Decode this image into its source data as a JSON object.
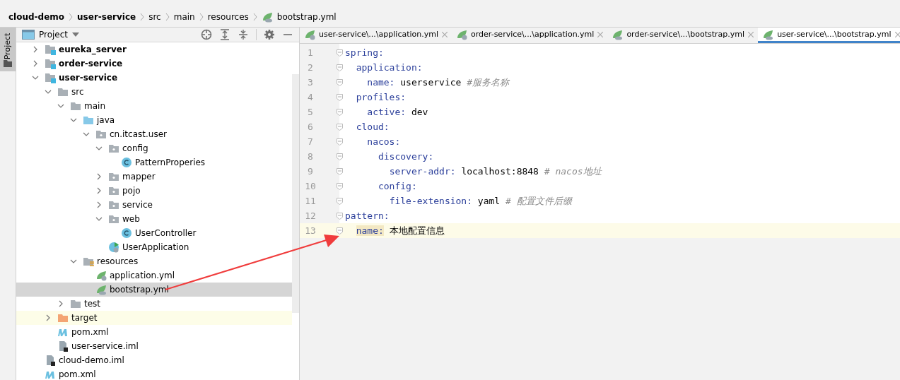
{
  "breadcrumb": [
    {
      "label": "cloud-demo",
      "kind": "module"
    },
    {
      "label": "user-service",
      "kind": "module"
    },
    {
      "label": "src",
      "kind": "folder"
    },
    {
      "label": "main",
      "kind": "folder"
    },
    {
      "label": "resources",
      "kind": "folder"
    },
    {
      "label": "bootstrap.yml",
      "kind": "bootstrap"
    }
  ],
  "side_tab": {
    "label": "Project",
    "selected": true
  },
  "project_panel": {
    "title": "Project",
    "tree": [
      {
        "label": "eureka_server",
        "kind": "module",
        "expanded": false,
        "selected": false
      },
      {
        "label": "order-service",
        "kind": "module",
        "expanded": false,
        "selected": false
      },
      {
        "label": "user-service",
        "kind": "module",
        "expanded": true,
        "selected": false,
        "children": [
          {
            "label": "src",
            "kind": "folder",
            "expanded": true,
            "selected": false,
            "children": [
              {
                "label": "main",
                "kind": "folder",
                "expanded": true,
                "selected": false,
                "children": [
                  {
                    "label": "java",
                    "kind": "source",
                    "expanded": true,
                    "selected": false,
                    "children": [
                      {
                        "label": "cn.itcast.user",
                        "kind": "package",
                        "expanded": true,
                        "selected": false,
                        "children": [
                          {
                            "label": "config",
                            "kind": "package",
                            "expanded": true,
                            "selected": false,
                            "children": [
                              {
                                "label": "PatternProperies",
                                "kind": "class",
                                "selected": false
                              }
                            ]
                          },
                          {
                            "label": "mapper",
                            "kind": "package",
                            "expanded": false,
                            "selected": false
                          },
                          {
                            "label": "pojo",
                            "kind": "package",
                            "expanded": false,
                            "selected": false
                          },
                          {
                            "label": "service",
                            "kind": "package",
                            "expanded": false,
                            "selected": false
                          },
                          {
                            "label": "web",
                            "kind": "package",
                            "expanded": true,
                            "selected": false,
                            "children": [
                              {
                                "label": "UserController",
                                "kind": "class",
                                "selected": false
                              }
                            ]
                          },
                          {
                            "label": "UserApplication",
                            "kind": "app",
                            "selected": false
                          }
                        ]
                      }
                    ]
                  },
                  {
                    "label": "resources",
                    "kind": "resources",
                    "expanded": true,
                    "selected": false,
                    "children": [
                      {
                        "label": "application.yml",
                        "kind": "application",
                        "selected": false
                      },
                      {
                        "label": "bootstrap.yml",
                        "kind": "bootstrap",
                        "selected": true
                      }
                    ]
                  }
                ]
              },
              {
                "label": "test",
                "kind": "folder",
                "expanded": false,
                "selected": false
              }
            ]
          },
          {
            "label": "target",
            "kind": "excluded",
            "expanded": false,
            "selected": false
          },
          {
            "label": "pom.xml",
            "kind": "maven",
            "selected": false
          },
          {
            "label": "user-service.iml",
            "kind": "iml",
            "selected": false
          }
        ]
      },
      {
        "label": "cloud-demo.iml",
        "kind": "iml",
        "selected": false
      },
      {
        "label": "pom.xml",
        "kind": "maven",
        "selected": false
      }
    ]
  },
  "tabs": [
    {
      "label": "user-service\\...\\application.yml",
      "kind": "application",
      "selected": false
    },
    {
      "label": "order-service\\...\\application.yml",
      "kind": "application",
      "selected": false
    },
    {
      "label": "order-service\\...\\bootstrap.yml",
      "kind": "bootstrap",
      "selected": false
    },
    {
      "label": "user-service\\...\\bootstrap.yml",
      "kind": "bootstrap",
      "selected": true
    }
  ],
  "code": [
    {
      "number": "1",
      "key": "spring:",
      "current": false
    },
    {
      "number": "2",
      "key": "  application:",
      "current": false
    },
    {
      "number": "3",
      "key": "    name:",
      "value": "userservice",
      "comment": "#服务名称",
      "current": false
    },
    {
      "number": "4",
      "key": "  profiles:",
      "current": false
    },
    {
      "number": "5",
      "key": "    active:",
      "value": "dev",
      "current": false
    },
    {
      "number": "6",
      "key": "  cloud:",
      "current": false
    },
    {
      "number": "7",
      "key": "    nacos:",
      "current": false
    },
    {
      "number": "8",
      "key": "      discovery:",
      "current": false
    },
    {
      "number": "9",
      "key": "        server-addr:",
      "value": "localhost:8848",
      "comment": "# nacos地址",
      "current": false
    },
    {
      "number": "10",
      "key": "      config:",
      "current": false
    },
    {
      "number": "11",
      "key": "        file-extension:",
      "value": "yaml",
      "comment": "# 配置文件后缀",
      "current": false
    },
    {
      "number": "12",
      "key": "pattern:",
      "current": false
    },
    {
      "number": "13",
      "key": "  name:",
      "value": "本地配置信息",
      "current": true
    }
  ]
}
